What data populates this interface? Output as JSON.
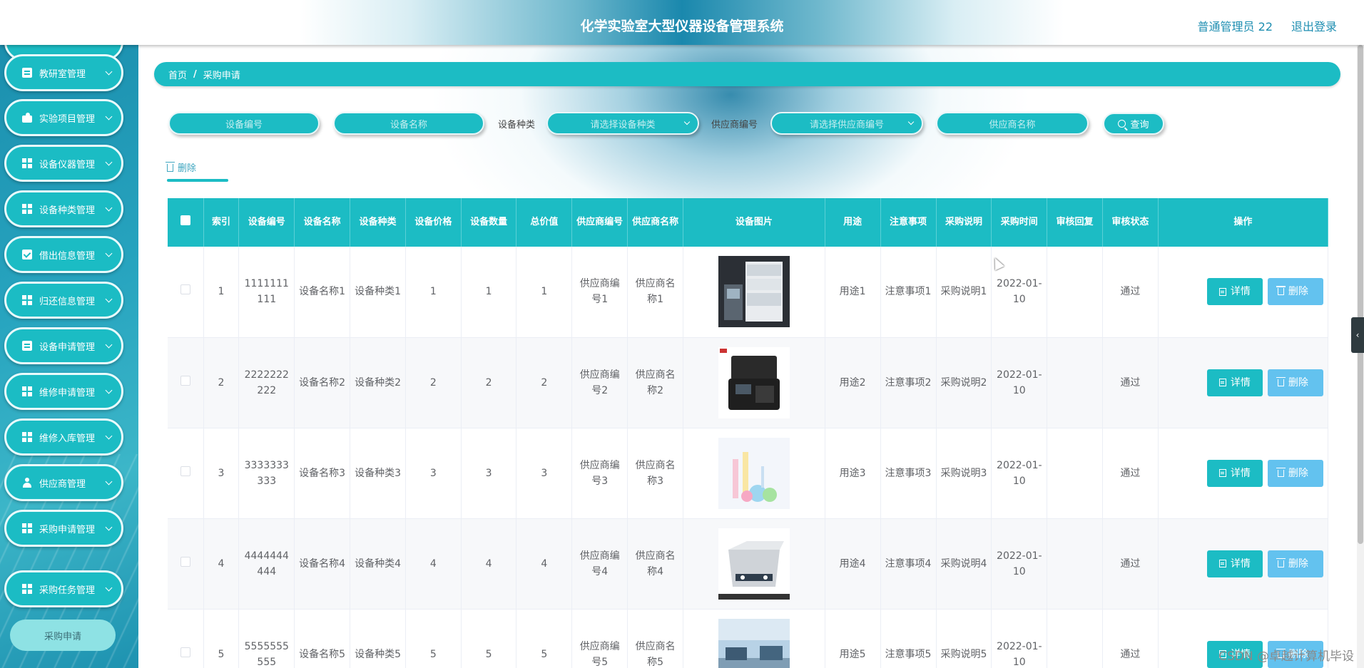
{
  "header": {
    "title": "化学实验室大型仪器设备管理系统",
    "user": "普通管理员 22",
    "logout": "退出登录"
  },
  "sidebar": {
    "items": [
      {
        "label": "教研室管理",
        "icon": "doc"
      },
      {
        "label": "实验项目管理",
        "icon": "gavel"
      },
      {
        "label": "设备仪器管理",
        "icon": "grid"
      },
      {
        "label": "设备种类管理",
        "icon": "grid"
      },
      {
        "label": "借出信息管理",
        "icon": "check"
      },
      {
        "label": "归还信息管理",
        "icon": "grid"
      },
      {
        "label": "设备申请管理",
        "icon": "doc"
      },
      {
        "label": "维修申请管理",
        "icon": "grid"
      },
      {
        "label": "维修入库管理",
        "icon": "grid"
      },
      {
        "label": "供应商管理",
        "icon": "person"
      },
      {
        "label": "采购申请管理",
        "icon": "grid"
      },
      {
        "label": "采购任务管理",
        "icon": "grid"
      }
    ],
    "active_sub": "采购申请"
  },
  "breadcrumb": {
    "home": "首页",
    "sep": "/",
    "current": "采购申请"
  },
  "search": {
    "device_code_placeholder": "设备编号",
    "device_name_placeholder": "设备名称",
    "type_label": "设备种类",
    "type_placeholder": "请选择设备种类",
    "supplier_code_label": "供应商编号",
    "supplier_code_placeholder": "请选择供应商编号",
    "supplier_name_placeholder": "供应商名称",
    "query_label": "查询"
  },
  "toolbar": {
    "delete_label": "删除"
  },
  "table": {
    "headers": [
      "索引",
      "设备编号",
      "设备名称",
      "设备种类",
      "设备价格",
      "设备数量",
      "总价值",
      "供应商编号",
      "供应商名称",
      "设备图片",
      "用途",
      "注意事项",
      "采购说明",
      "采购时间",
      "审核回复",
      "审核状态",
      "操作"
    ],
    "rows": [
      {
        "index": "1",
        "code": "1111111111",
        "name": "设备名称1",
        "type": "设备种类1",
        "price": "1",
        "qty": "1",
        "total": "1",
        "supplier_code": "供应商编号1",
        "supplier_name": "供应商名称1",
        "image": "hplc-instrument",
        "usage": "用途1",
        "notes": "注意事项1",
        "desc": "采购说明1",
        "time": "2022-01-10",
        "reply": "",
        "status": "通过"
      },
      {
        "index": "2",
        "code": "2222222222",
        "name": "设备名称2",
        "type": "设备种类2",
        "price": "2",
        "qty": "2",
        "total": "2",
        "supplier_code": "供应商编号2",
        "supplier_name": "供应商名称2",
        "image": "portable-kit-case",
        "usage": "用途2",
        "notes": "注意事项2",
        "desc": "采购说明2",
        "time": "2022-01-10",
        "reply": "",
        "status": "通过"
      },
      {
        "index": "3",
        "code": "3333333333",
        "name": "设备名称3",
        "type": "设备种类3",
        "price": "3",
        "qty": "3",
        "total": "3",
        "supplier_code": "供应商编号3",
        "supplier_name": "供应商名称3",
        "image": "lab-glassware",
        "usage": "用途3",
        "notes": "注意事项3",
        "desc": "采购说明3",
        "time": "2022-01-10",
        "reply": "",
        "status": "通过"
      },
      {
        "index": "4",
        "code": "4444444444",
        "name": "设备名称4",
        "type": "设备种类4",
        "price": "4",
        "qty": "4",
        "total": "4",
        "supplier_code": "供应商编号4",
        "supplier_name": "供应商名称4",
        "image": "ultrasonic-cleaner",
        "usage": "用途4",
        "notes": "注意事项4",
        "desc": "采购说明4",
        "time": "2022-01-10",
        "reply": "",
        "status": "通过"
      },
      {
        "index": "5",
        "code": "5555555555",
        "name": "设备名称5",
        "type": "设备种类5",
        "price": "5",
        "qty": "5",
        "total": "5",
        "supplier_code": "供应商编号5",
        "supplier_name": "供应商名称5",
        "image": "lab-room",
        "usage": "用途5",
        "notes": "注意事项5",
        "desc": "采购说明5",
        "time": "2022-01-10",
        "reply": "",
        "status": "通过"
      }
    ],
    "detail_label": "详情",
    "delete_label": "删除"
  },
  "watermark": "CSDN @卓越计算机毕设",
  "colors": {
    "accent": "#1cbcc4",
    "delete_button": "#63c2ef",
    "header_text": "#1e8eb1"
  }
}
